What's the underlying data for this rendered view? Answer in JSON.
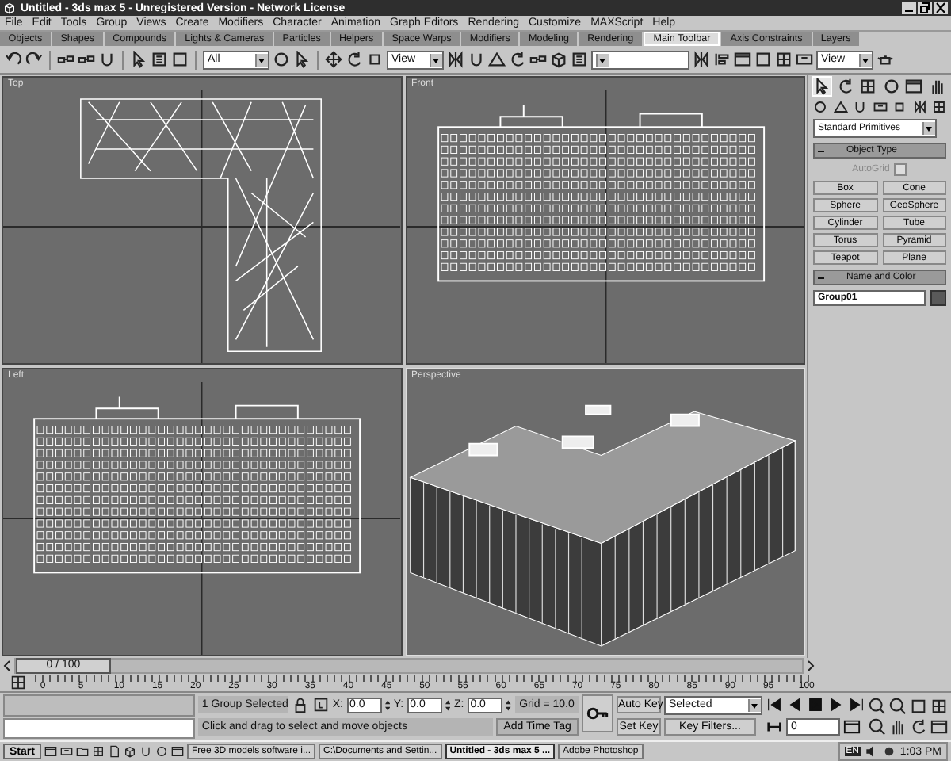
{
  "window": {
    "title": "Untitled - 3ds max 5 - Unregistered Version - Network License"
  },
  "menu": [
    "File",
    "Edit",
    "Tools",
    "Group",
    "Views",
    "Create",
    "Modifiers",
    "Character",
    "Animation",
    "Graph Editors",
    "Rendering",
    "Customize",
    "MAXScript",
    "Help"
  ],
  "tabs": [
    {
      "label": "Objects",
      "selected": false
    },
    {
      "label": "Shapes",
      "selected": false
    },
    {
      "label": "Compounds",
      "selected": false
    },
    {
      "label": "Lights & Cameras",
      "selected": false
    },
    {
      "label": "Particles",
      "selected": false
    },
    {
      "label": "Helpers",
      "selected": false
    },
    {
      "label": "Space Warps",
      "selected": false
    },
    {
      "label": "Modifiers",
      "selected": false
    },
    {
      "label": "Modeling",
      "selected": false
    },
    {
      "label": "Rendering",
      "selected": false
    },
    {
      "label": "Main Toolbar",
      "selected": true
    },
    {
      "label": "Axis Constraints",
      "selected": false
    },
    {
      "label": "Layers",
      "selected": false
    }
  ],
  "toolbar": {
    "selection_filter": "All",
    "reference_coordinates": "View",
    "render_view": "View"
  },
  "viewports": [
    {
      "label": "Top",
      "kind": "top"
    },
    {
      "label": "Front",
      "kind": "front"
    },
    {
      "label": "Left",
      "kind": "left"
    },
    {
      "label": "Perspective",
      "kind": "perspective"
    }
  ],
  "command_panel": {
    "category": "Standard Primitives",
    "object_type": {
      "title": "Object Type",
      "autogrid": {
        "label": "AutoGrid",
        "checked": false,
        "disabled": true
      },
      "buttons": [
        "Box",
        "Cone",
        "Sphere",
        "GeoSphere",
        "Cylinder",
        "Tube",
        "Torus",
        "Pyramid",
        "Teapot",
        "Plane"
      ]
    },
    "name_and_color": {
      "title": "Name and Color",
      "name": "Group01",
      "color": "#5a5a5a"
    }
  },
  "time_slider": {
    "label": "0 / 100",
    "level": 0
  },
  "ruler_ticks": [
    "0",
    "5",
    "10",
    "15",
    "20",
    "25",
    "30",
    "35",
    "40",
    "45",
    "50",
    "55",
    "60",
    "65",
    "70",
    "75",
    "80",
    "85",
    "90",
    "95",
    "100"
  ],
  "status": {
    "selection": "1 Group Selected",
    "prompt": "Click and drag to select and move objects",
    "coords": [
      {
        "label": "X:",
        "value": "0.0"
      },
      {
        "label": "Y:",
        "value": "0.0"
      },
      {
        "label": "Z:",
        "value": "0.0"
      }
    ],
    "grid": "Grid = 10.0",
    "add_time_tag": "Add Time Tag",
    "auto_key": "Auto Key",
    "key_mode": "Selected",
    "set_key": "Set Key",
    "key_filters": "Key Filters...",
    "current_frame": "0"
  },
  "taskbar": {
    "start": "Start",
    "tasks": [
      {
        "label": "Free 3D models software i...",
        "selected": false
      },
      {
        "label": "C:\\Documents and Settin...",
        "selected": false
      },
      {
        "label": "Untitled - 3ds max 5 ...",
        "selected": true
      },
      {
        "label": "Adobe Photoshop",
        "selected": false
      }
    ],
    "language": "EN",
    "clock": "1:03 PM"
  }
}
